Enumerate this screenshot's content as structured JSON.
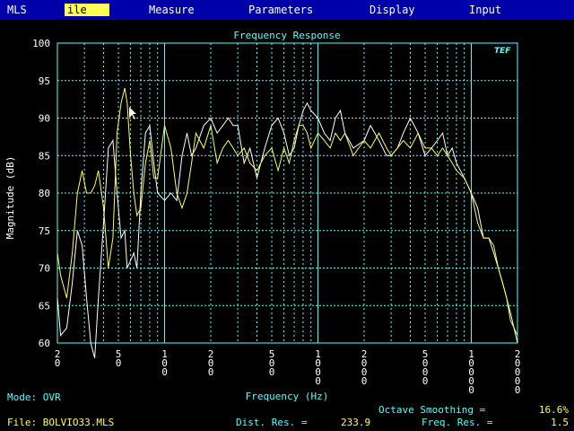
{
  "menu": [
    {
      "label": "MLS",
      "active": false
    },
    {
      "label": "ile",
      "active": true
    },
    {
      "label": "Measure",
      "active": false
    },
    {
      "label": "Parameters",
      "active": false
    },
    {
      "label": "Display",
      "active": false
    },
    {
      "label": "Input",
      "active": false
    }
  ],
  "logo_text": "TEF",
  "status": {
    "mode_label": "Mode:",
    "mode_value": "OVR",
    "file_label": "File:",
    "file_value": "BOLVIO33.MLS",
    "octave_label": "Octave Smoothing =",
    "octave_value": "16.6%",
    "dist_label": "Dist. Res. =",
    "dist_value": "233.9",
    "freq_label": "Freq. Res. =",
    "freq_value": "1.5"
  },
  "chart_data": {
    "type": "line",
    "title": "Frequency Response",
    "xlabel": "Frequency (Hz)",
    "ylabel": "Magnitude (dB)",
    "x_scale": "log",
    "xlim": [
      20,
      20000
    ],
    "ylim": [
      60,
      100
    ],
    "grid": true,
    "yticks": [
      100,
      95,
      90,
      85,
      80,
      75,
      70,
      65,
      60
    ],
    "xticks": [
      "20",
      "50",
      "100",
      "200",
      "500",
      "1000",
      "2000",
      "5000",
      "10000",
      "20000"
    ],
    "colors": {
      "series_white": "#ffffff",
      "series_yellow": "#ffff55",
      "axis": "#55ffff",
      "grid": "#55ffff"
    },
    "series": [
      {
        "color": "white",
        "x": [
          20,
          21,
          23,
          25,
          27,
          29,
          31,
          33,
          35,
          37,
          40,
          43,
          46,
          49,
          52,
          55,
          57,
          60,
          63,
          66,
          70,
          75,
          80,
          85,
          90,
          100,
          110,
          120,
          130,
          140,
          150,
          160,
          180,
          200,
          220,
          240,
          260,
          280,
          300,
          330,
          360,
          400,
          450,
          500,
          550,
          600,
          650,
          700,
          750,
          800,
          850,
          900,
          1000,
          1100,
          1200,
          1300,
          1400,
          1500,
          1700,
          2000,
          2200,
          2500,
          2800,
          3000,
          3300,
          3600,
          4000,
          4500,
          5000,
          5500,
          6000,
          6500,
          7000,
          7500,
          8000,
          9000,
          10000,
          11000,
          12000,
          13000,
          14000,
          15000,
          16000,
          17000,
          18000,
          20000
        ],
        "y": [
          66,
          61,
          62,
          68,
          75,
          73,
          66,
          60,
          58,
          66,
          76,
          86,
          87,
          80,
          74,
          75,
          70,
          71,
          72,
          70,
          80,
          88,
          89,
          84,
          80,
          79,
          80,
          79,
          85,
          88,
          85,
          86,
          89,
          90,
          88,
          89,
          90,
          89,
          89,
          84,
          86,
          82,
          86,
          89,
          90,
          88,
          85,
          86,
          89,
          91,
          92,
          91,
          90,
          88,
          87,
          90,
          91,
          88,
          86,
          87,
          89,
          87,
          85,
          85,
          86,
          88,
          90,
          88,
          85,
          86,
          87,
          88,
          85,
          86,
          84,
          82,
          80,
          78,
          74,
          74,
          72,
          70,
          68,
          66,
          64,
          60
        ]
      },
      {
        "color": "yellow",
        "x": [
          20,
          21,
          23,
          25,
          27,
          29,
          31,
          33,
          35,
          37,
          40,
          43,
          46,
          49,
          52,
          55,
          57,
          60,
          63,
          66,
          70,
          75,
          80,
          85,
          90,
          100,
          110,
          120,
          130,
          140,
          150,
          160,
          180,
          200,
          220,
          240,
          260,
          280,
          300,
          330,
          360,
          400,
          450,
          500,
          550,
          600,
          650,
          700,
          750,
          800,
          850,
          900,
          1000,
          1100,
          1200,
          1300,
          1400,
          1500,
          1700,
          2000,
          2200,
          2500,
          2800,
          3000,
          3300,
          3600,
          4000,
          4500,
          5000,
          5500,
          6000,
          6500,
          7000,
          7500,
          8000,
          9000,
          10000,
          11000,
          12000,
          13000,
          14000,
          15000,
          16000,
          17000,
          18000,
          20000
        ],
        "y": [
          72,
          69,
          66,
          72,
          80,
          83,
          80,
          80,
          81,
          83,
          78,
          70,
          74,
          88,
          92,
          94,
          92,
          85,
          80,
          77,
          78,
          84,
          87,
          82,
          82,
          89,
          86,
          80,
          78,
          80,
          84,
          88,
          86,
          89,
          84,
          86,
          87,
          86,
          85,
          86,
          84,
          83,
          85,
          86,
          83,
          86,
          84,
          87,
          89,
          89,
          88,
          86,
          88,
          87,
          86,
          88,
          87,
          88,
          85,
          87,
          86,
          88,
          86,
          85,
          86,
          87,
          86,
          88,
          86,
          86,
          85,
          86,
          85,
          84,
          83,
          82,
          80,
          76,
          74,
          74,
          73,
          70,
          68,
          66,
          63,
          61
        ]
      }
    ]
  }
}
